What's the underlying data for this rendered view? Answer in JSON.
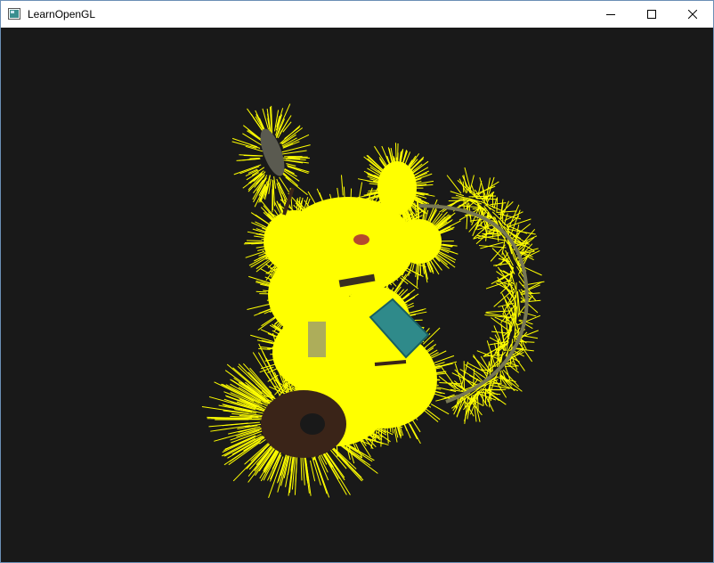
{
  "window": {
    "title": "LearnOpenGL",
    "controls": {
      "minimize_icon": "minimize-icon",
      "maximize_icon": "maximize-icon",
      "close_icon": "close-icon"
    }
  },
  "viewport": {
    "background": "#191919",
    "model_color": "#ffff00",
    "description_icon": "normal-visualization-render"
  }
}
